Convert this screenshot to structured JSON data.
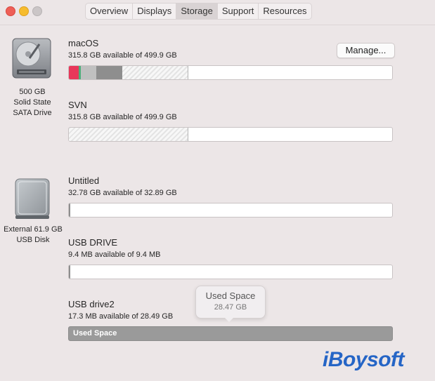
{
  "tabs": [
    {
      "label": "Overview",
      "active": false
    },
    {
      "label": "Displays",
      "active": false
    },
    {
      "label": "Storage",
      "active": true
    },
    {
      "label": "Support",
      "active": false
    },
    {
      "label": "Resources",
      "active": false
    }
  ],
  "internal_disk": {
    "icon": "internal-drive-icon",
    "caption_lines": [
      "500 GB",
      "Solid State",
      "SATA Drive"
    ]
  },
  "external_disk": {
    "icon": "external-drive-icon",
    "caption_lines": [
      "External 61.9 GB",
      "USB Disk"
    ]
  },
  "manage_label": "Manage...",
  "volumes": [
    {
      "name": "macOS",
      "info": "315.8 GB available of 499.9 GB"
    },
    {
      "name": "SVN",
      "info": "315.8 GB available of 499.9 GB"
    },
    {
      "name": "Untitled",
      "info": "32.78 GB available of 32.89 GB"
    },
    {
      "name": "USB DRIVE",
      "info": "9.4 MB available of 9.4 MB"
    },
    {
      "name": "USB drive2",
      "info": "17.3 MB available of 28.49 GB"
    }
  ],
  "used_space_label": "Used Space",
  "tooltip": {
    "title": "Used Space",
    "value": "28.47 GB"
  },
  "colors": {
    "apps": "#e8375a",
    "documents": "#4caf7a",
    "system": "#c0c0c0",
    "other": "#8e8e8e",
    "used_full": "#9a9a9a"
  },
  "watermark": "iBoysoft"
}
